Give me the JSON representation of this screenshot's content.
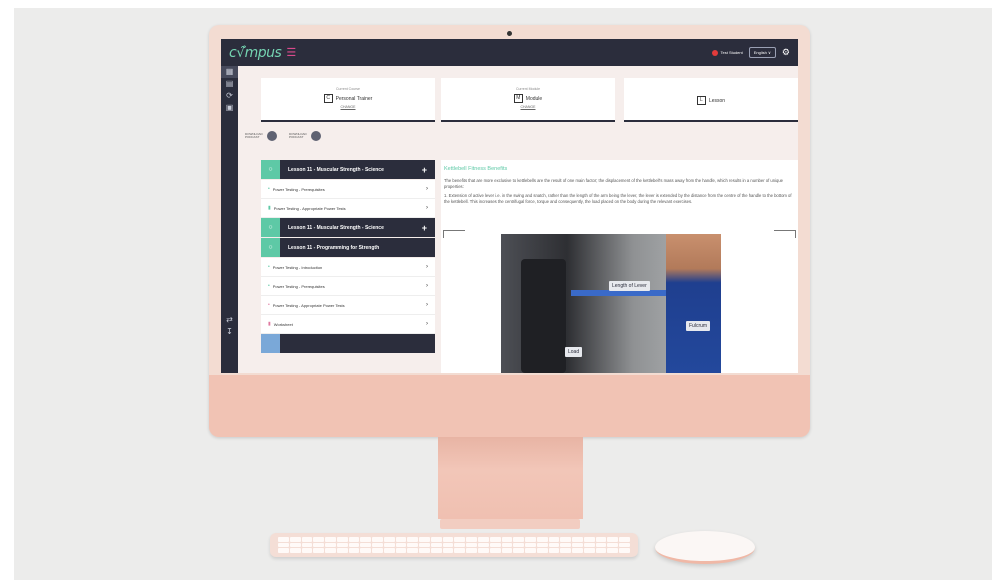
{
  "app": {
    "logo": "c√̃mpus",
    "student_name": "Test Student",
    "language": "English ∨",
    "colors": {
      "accent": "#5ec9a6",
      "topbar": "#2b2d3c",
      "chassis": "#f3dcd2"
    }
  },
  "rail": {
    "icons": [
      "dashboard-icon",
      "book-icon",
      "support-icon",
      "notes-icon",
      "directions-icon",
      "download-icon"
    ]
  },
  "cards": [
    {
      "caption": "Current Course",
      "letter": "C",
      "title": "Personal Trainer",
      "change": "CHANGE"
    },
    {
      "caption": "Current Module",
      "letter": "M",
      "title": "Module",
      "change": "CHANGE"
    },
    {
      "caption": "",
      "letter": "L",
      "title": "Lesson",
      "change": ""
    }
  ],
  "podcasts": [
    {
      "label": "DOWNLOAD PODCAST"
    },
    {
      "label": "DOWNLOAD PODCAST"
    }
  ],
  "lessons": {
    "group1": {
      "title": "Lesson 11 - Muscular Strength - Science",
      "toggle": "+"
    },
    "group1_items": [
      "Power Testing - Prerequisites",
      "Power Testing - Appropriate Power Tests"
    ],
    "group2": {
      "title": "Lesson 11 - Muscular Strength - Science",
      "toggle": "+"
    },
    "group3": {
      "title": "Lesson 11 - Programming for Strength"
    },
    "group3_items": [
      "Power Testing - Introduction",
      "Power Testing - Prerequisites",
      "Power Testing - Appropriate Power Tests",
      "Worksheet"
    ]
  },
  "content": {
    "title": "Kettlebell Fitness Benefits",
    "para1": "The benefits that are more exclusive to kettlebells are the result of one main factor; the displacement of the kettlebell's mass away from the handle, which results in a number of unique properties:",
    "para2": "1. Extension of active lever i.e. in the swing and snatch, rather than the length of the arm being the lever, the lever is extended by the distance from the centre of the handle to the bottom of the kettlebell. This increases the centrifugal force, torque and consequently, the load placed on the body during the relevant exercises.",
    "figure": {
      "lever_label": "Length of Lever",
      "fulcrum_label": "Fulcrum",
      "load_label": "Load"
    }
  }
}
